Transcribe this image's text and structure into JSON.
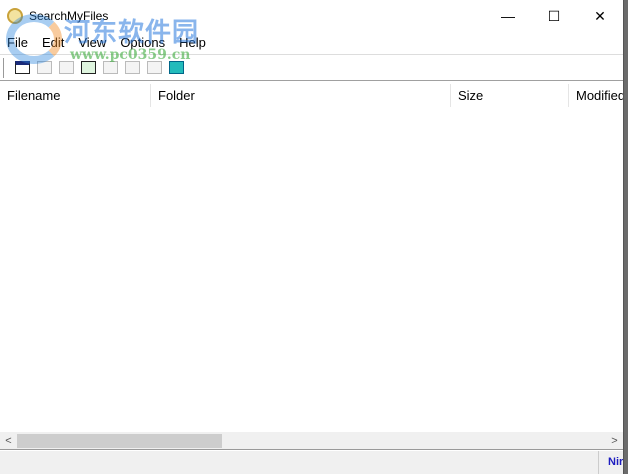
{
  "window": {
    "title": "SearchMyFiles",
    "minimize": "—",
    "maximize": "☐",
    "close": "✕"
  },
  "menu": [
    "File",
    "Edit",
    "View",
    "Options",
    "Help"
  ],
  "toolbar": [
    "open-options",
    "save-disabled",
    "save-items",
    "refresh",
    "copy",
    "properties",
    "find",
    "exit"
  ],
  "columns": [
    "Filename",
    "Folder",
    "Size",
    "Modified"
  ],
  "scroll": {
    "left": "<",
    "right": ">"
  },
  "status": {
    "brand": "NirSoft"
  },
  "watermark": {
    "text": "河东软件园",
    "url": "www.pc0359.cn"
  }
}
